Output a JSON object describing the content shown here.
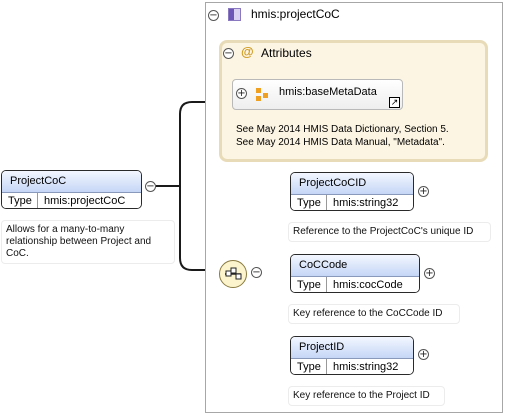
{
  "root_element": {
    "name": "ProjectCoC",
    "type_label": "Type",
    "type_value": "hmis:projectCoC",
    "description": "Allows for a many-to-many relationship between Project and CoC."
  },
  "complex_type": {
    "name": "hmis:projectCoC",
    "collapse_symbol": "−",
    "attributes": {
      "title": "Attributes",
      "collapse_symbol": "−",
      "group": {
        "name": "hmis:baseMetaData",
        "expand_symbol": "+",
        "link_symbol": "↗",
        "doc_lines": [
          "See May 2014 HMIS Data Dictionary, Section 5.",
          "See May 2014 HMIS Data Manual, \"Metadata\"."
        ]
      }
    },
    "children": [
      {
        "name": "ProjectCoCID",
        "type_label": "Type",
        "type_value": "hmis:string32",
        "description": "Reference to the ProjectCoC's unique ID"
      },
      {
        "name": "CoCCode",
        "type_label": "Type",
        "type_value": "hmis:cocCode",
        "description": "Key reference to the CoCCode ID"
      },
      {
        "name": "ProjectID",
        "type_label": "Type",
        "type_value": "hmis:string32",
        "description": "Key reference to the Project ID"
      }
    ]
  },
  "symbols": {
    "collapse": "−",
    "expand": "+",
    "at": "@"
  },
  "colors": {
    "element_header_top": "#f3f7ff",
    "element_header_bottom": "#c5d6f6",
    "attribute_bg": "#fcf5e3",
    "attribute_border": "#e8dbb8",
    "sequence_bg": "#fbf4cc"
  }
}
